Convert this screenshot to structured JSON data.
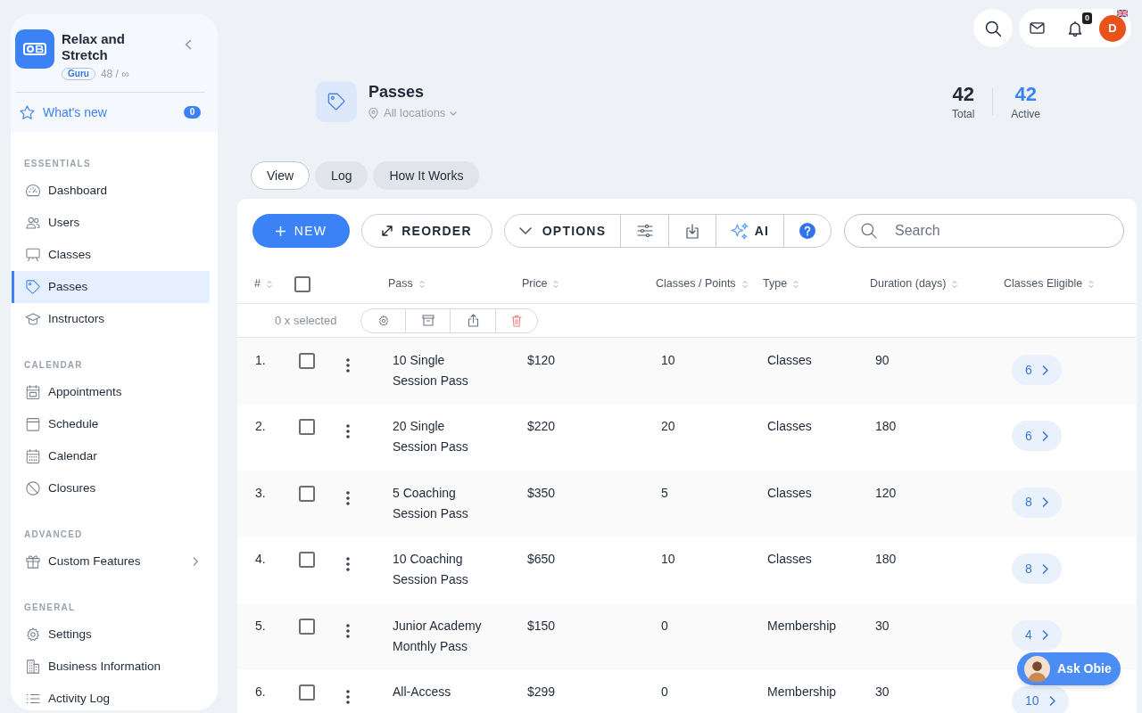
{
  "sidebar": {
    "business": {
      "name": "Relax and Stretch",
      "plan": "Guru",
      "usage": "48 / ∞"
    },
    "whats_new": {
      "label": "What's new",
      "count": "0"
    },
    "sections": [
      {
        "title": "ESSENTIALS",
        "items": [
          {
            "label": "Dashboard",
            "kind": "link",
            "selected": false
          },
          {
            "label": "Users",
            "kind": "link",
            "selected": false
          },
          {
            "label": "Classes",
            "kind": "link",
            "selected": false
          },
          {
            "label": "Passes",
            "kind": "link",
            "selected": true
          },
          {
            "label": "Instructors",
            "kind": "link",
            "selected": false
          }
        ]
      },
      {
        "title": "CALENDAR",
        "items": [
          {
            "label": "Appointments",
            "kind": "link",
            "selected": false
          },
          {
            "label": "Schedule",
            "kind": "link",
            "selected": false
          },
          {
            "label": "Calendar",
            "kind": "link",
            "selected": false
          },
          {
            "label": "Closures",
            "kind": "link",
            "selected": false
          }
        ]
      },
      {
        "title": "ADVANCED",
        "items": [
          {
            "label": "Custom Features",
            "kind": "submenu",
            "selected": false
          }
        ]
      },
      {
        "title": "GENERAL",
        "items": [
          {
            "label": "Settings",
            "kind": "link",
            "selected": false
          },
          {
            "label": "Business Information",
            "kind": "link",
            "selected": false
          },
          {
            "label": "Activity Log",
            "kind": "link",
            "selected": false
          }
        ]
      }
    ]
  },
  "topbar": {
    "notification_count": "0",
    "avatar_initial": "D"
  },
  "header": {
    "title": "Passes",
    "location": "All locations",
    "stats": [
      {
        "value": "42",
        "label": "Total",
        "kind": "total"
      },
      {
        "value": "42",
        "label": "Active",
        "kind": "active"
      }
    ]
  },
  "tabs": [
    {
      "label": "View",
      "selected": true
    },
    {
      "label": "Log",
      "selected": false
    },
    {
      "label": "How It Works",
      "selected": false
    }
  ],
  "toolbar": {
    "new_label": "NEW",
    "reorder_label": "REORDER",
    "options_label": "OPTIONS",
    "ai_label": "AI",
    "search_placeholder": "Search"
  },
  "table": {
    "select_all": {
      "checked": false
    },
    "columns": [
      {
        "label": "#"
      },
      {
        "label": "Pass"
      },
      {
        "label": "Price"
      },
      {
        "label": "Classes / Points"
      },
      {
        "label": "Type"
      },
      {
        "label": "Duration (days)"
      },
      {
        "label": "Classes Eligible"
      }
    ],
    "selection_summary": "0 x selected",
    "rows": [
      {
        "number": "1.",
        "name": "10 Single Session Pass",
        "price": "$120",
        "classes_points": "10",
        "type": "Classes",
        "duration": "90",
        "classes_eligible": "6",
        "checked": false
      },
      {
        "number": "2.",
        "name": "20 Single Session Pass",
        "price": "$220",
        "classes_points": "20",
        "type": "Classes",
        "duration": "180",
        "classes_eligible": "6",
        "checked": false
      },
      {
        "number": "3.",
        "name": "5 Coaching Session Pass",
        "price": "$350",
        "classes_points": "5",
        "type": "Classes",
        "duration": "120",
        "classes_eligible": "8",
        "checked": false
      },
      {
        "number": "4.",
        "name": "10 Coaching Session Pass",
        "price": "$650",
        "classes_points": "10",
        "type": "Classes",
        "duration": "180",
        "classes_eligible": "8",
        "checked": false
      },
      {
        "number": "5.",
        "name": "Junior Academy Monthly Pass",
        "price": "$150",
        "classes_points": "0",
        "type": "Membership",
        "duration": "30",
        "classes_eligible": "4",
        "checked": false
      },
      {
        "number": "6.",
        "name": "All-Access",
        "price": "$299",
        "classes_points": "0",
        "type": "Membership",
        "duration": "30",
        "classes_eligible": "10",
        "checked": false
      }
    ]
  },
  "assistant": {
    "label": "Ask Obie"
  }
}
